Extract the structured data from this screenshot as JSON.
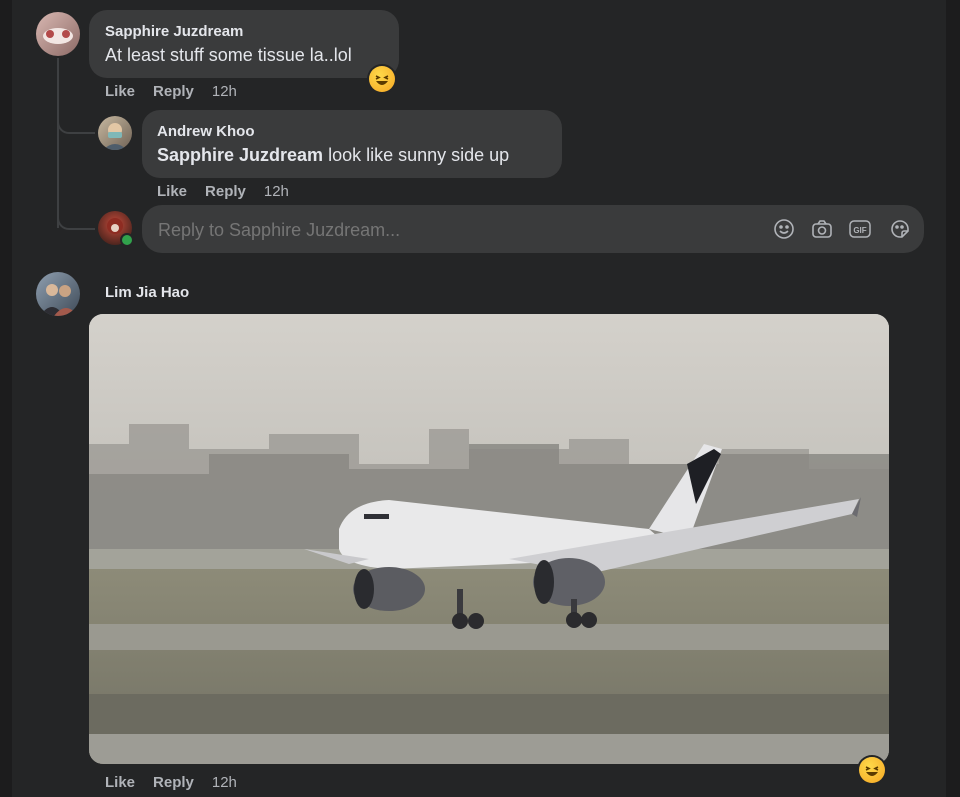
{
  "comments": {
    "c1": {
      "author": "Sapphire Juzdream",
      "text": "At least stuff some tissue la..lol",
      "actions": {
        "like": "Like",
        "reply": "Reply",
        "time": "12h"
      }
    },
    "c2": {
      "author": "Andrew Khoo",
      "mention": "Sapphire Juzdream",
      "text": " look like sunny side up",
      "actions": {
        "like": "Like",
        "reply": "Reply",
        "time": "12h"
      }
    },
    "reply_box": {
      "placeholder": "Reply to Sapphire Juzdream..."
    },
    "c3": {
      "author": "Lim Jia Hao",
      "actions": {
        "like": "Like",
        "reply": "Reply",
        "time": "12h"
      }
    }
  },
  "icons": {
    "reply_box": [
      "emoji-icon",
      "camera-icon",
      "gif-icon",
      "sticker-icon"
    ],
    "reaction": "laughing-emoji-icon"
  },
  "colors": {
    "background": "#242526",
    "bubble": "#3a3b3c",
    "text": "#e4e6eb",
    "secondary_text": "#b0b3b8"
  }
}
